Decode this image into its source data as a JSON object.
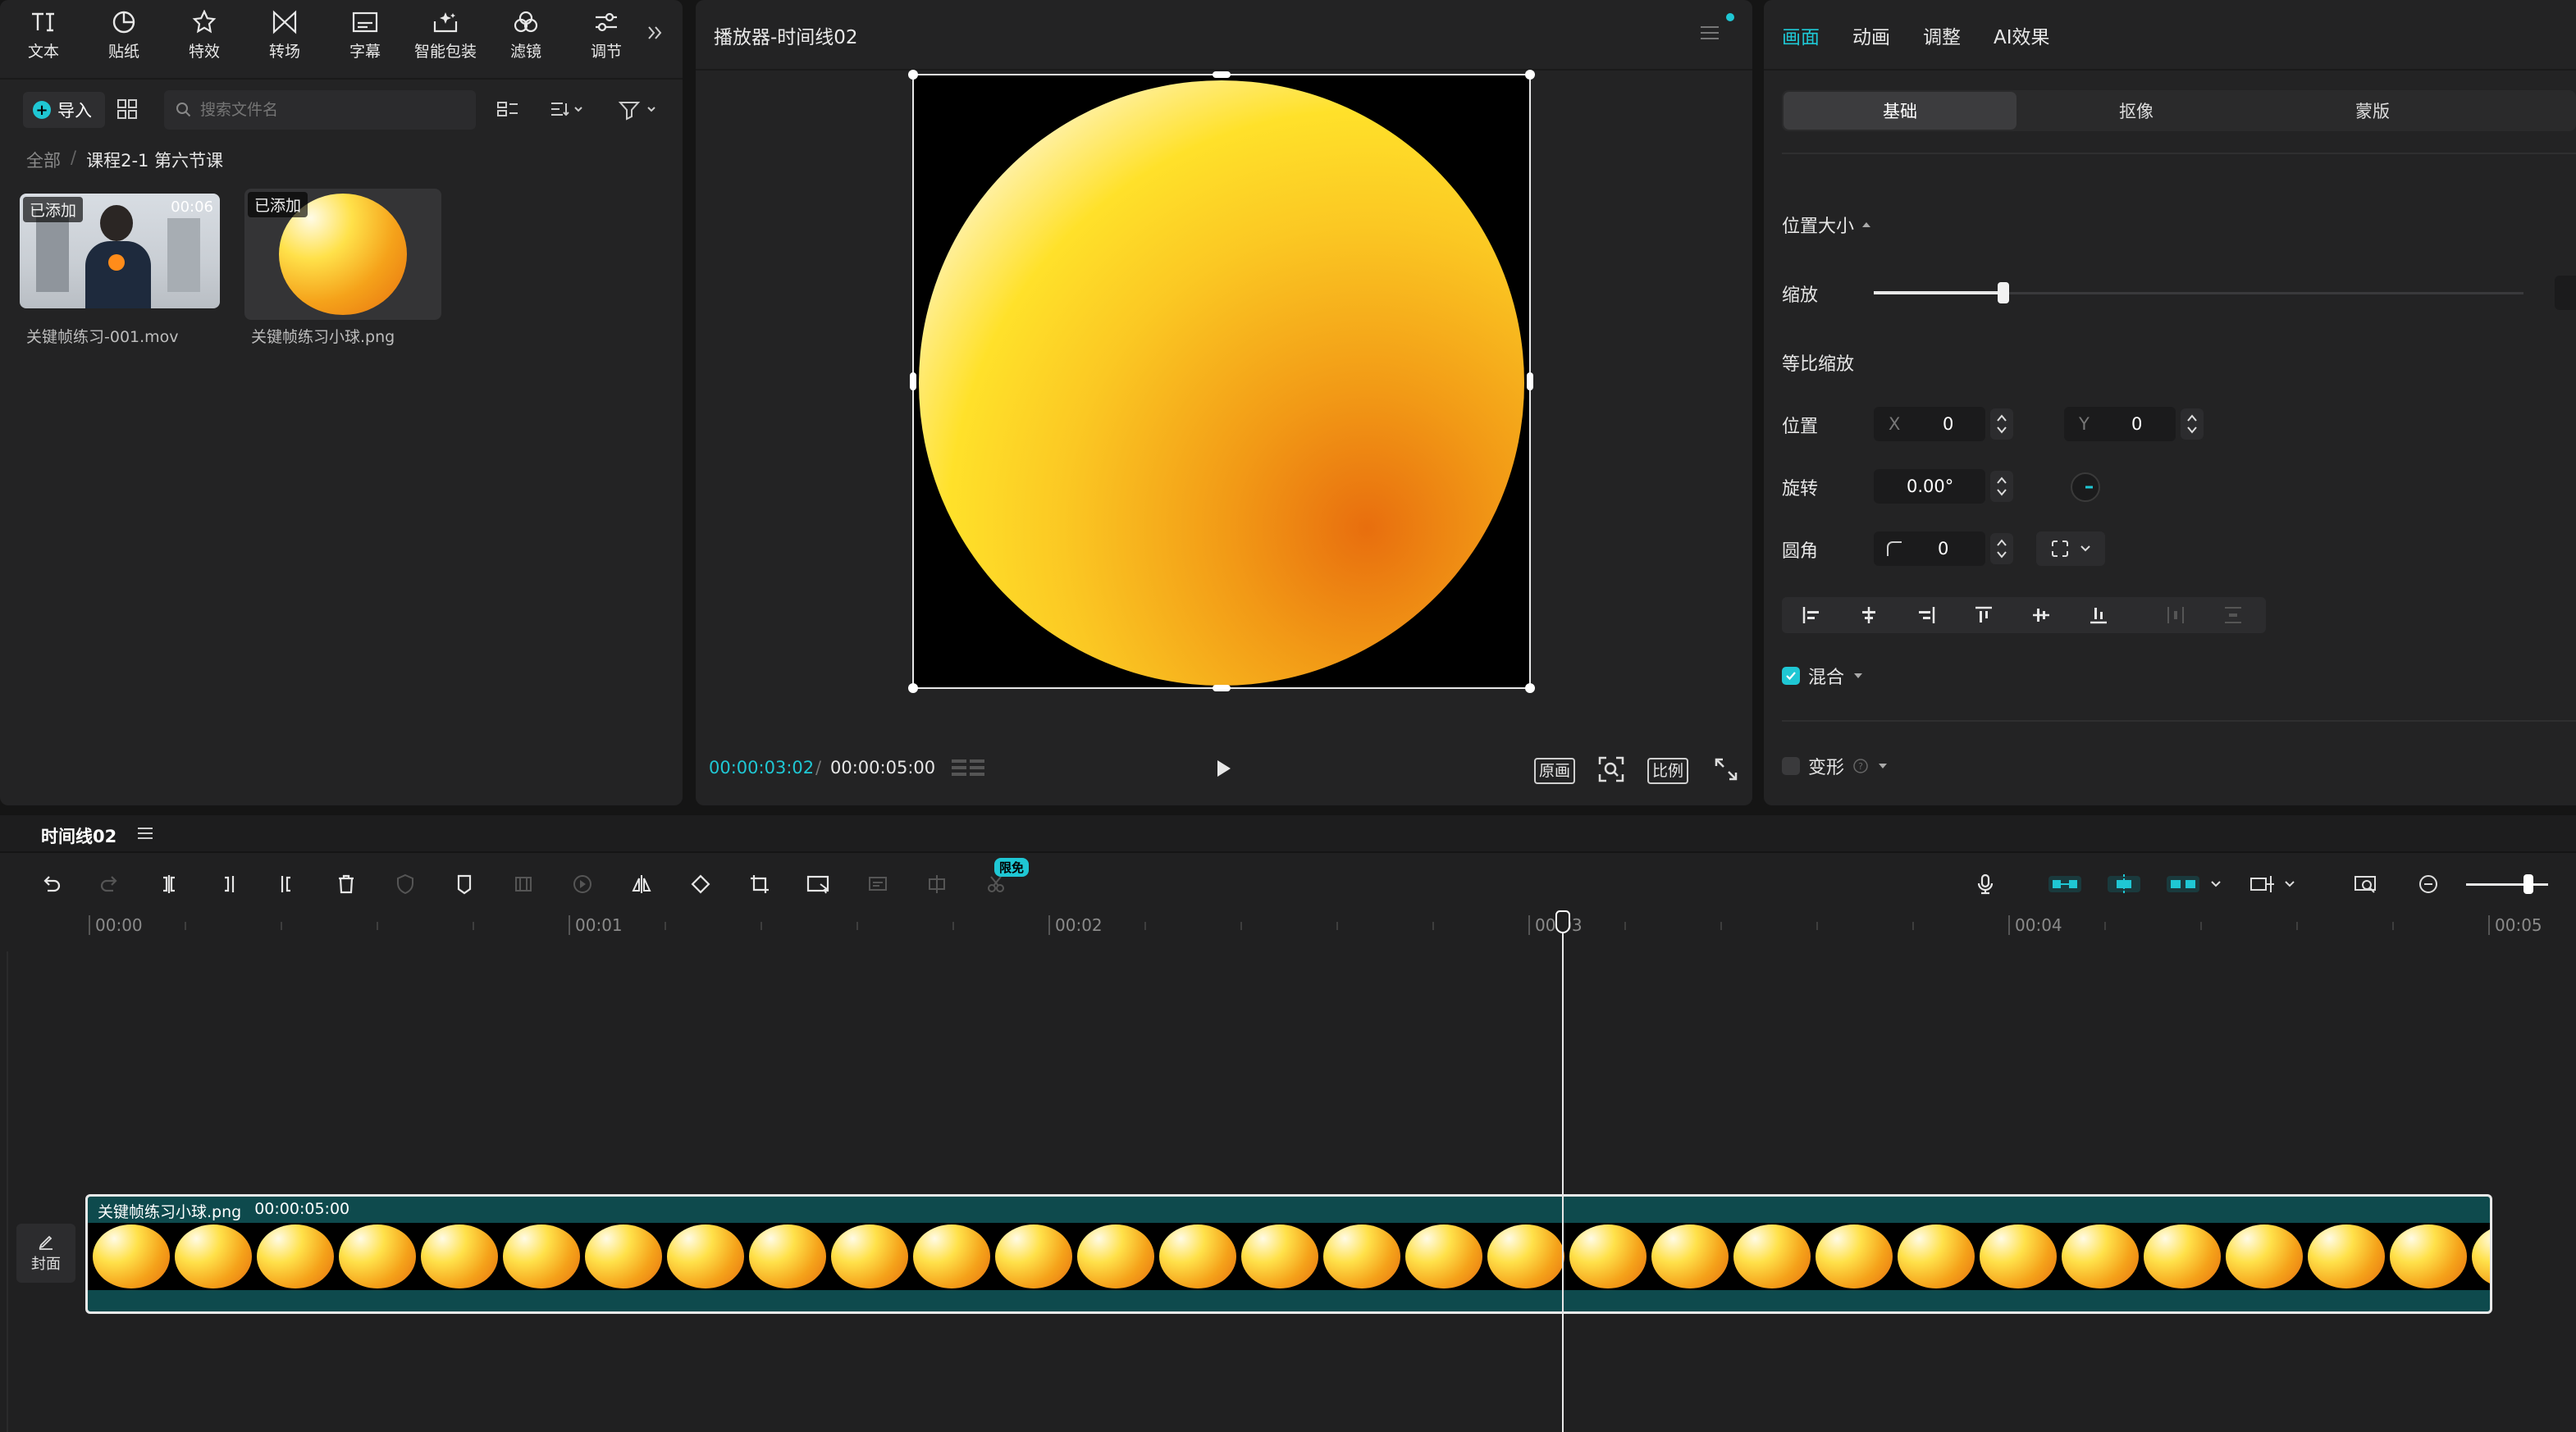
{
  "toolbar": {
    "tools": [
      {
        "label": "文本",
        "icon": "text-icon"
      },
      {
        "label": "贴纸",
        "icon": "sticker-icon"
      },
      {
        "label": "特效",
        "icon": "effects-icon"
      },
      {
        "label": "转场",
        "icon": "transition-icon"
      },
      {
        "label": "字幕",
        "icon": "subtitle-icon"
      },
      {
        "label": "智能包装",
        "icon": "smart-package-icon"
      },
      {
        "label": "滤镜",
        "icon": "filter-icon"
      },
      {
        "label": "调节",
        "icon": "adjust-icon"
      }
    ]
  },
  "media": {
    "import_label": "导入",
    "search_placeholder": "搜索文件名",
    "breadcrumb_root": "全部",
    "breadcrumb_sep": "/",
    "breadcrumb_current": "课程2-1 第六节课",
    "items": [
      {
        "name": "关键帧练习-001.mov",
        "badge": "已添加",
        "duration": "00:06"
      },
      {
        "name": "关键帧练习小球.png",
        "badge": "已添加"
      }
    ]
  },
  "player": {
    "title": "播放器-时间线02",
    "current_time": "00:00:03:02",
    "separator": "/",
    "total_time": "00:00:05:00",
    "original_label": "原画",
    "ratio_label": "比例"
  },
  "inspector": {
    "tabs": [
      "画面",
      "动画",
      "调整",
      "AI效果"
    ],
    "active_tab": "画面",
    "subtabs": [
      "基础",
      "抠像",
      "蒙版"
    ],
    "section_title": "位置大小",
    "scale_label": "缩放",
    "scale_fraction": 0.2,
    "uniform_scale_label": "等比缩放",
    "position_label": "位置",
    "pos_x_label": "X",
    "pos_x": "0",
    "pos_y_label": "Y",
    "pos_y": "0",
    "rotation_label": "旋转",
    "rotation": "0.00°",
    "corner_label": "圆角",
    "corner": "0",
    "blend_label": "混合",
    "transform_label": "变形",
    "accent": "#1fc7d4"
  },
  "timeline": {
    "title": "时间线02",
    "free_badge": "限免",
    "ticks": [
      "00:00",
      "00:01",
      "00:02",
      "00:03",
      "00:04",
      "00:05"
    ],
    "clip_name": "关键帧练习小球.png",
    "clip_duration": "00:00:05:00",
    "cover_label": "封面"
  }
}
